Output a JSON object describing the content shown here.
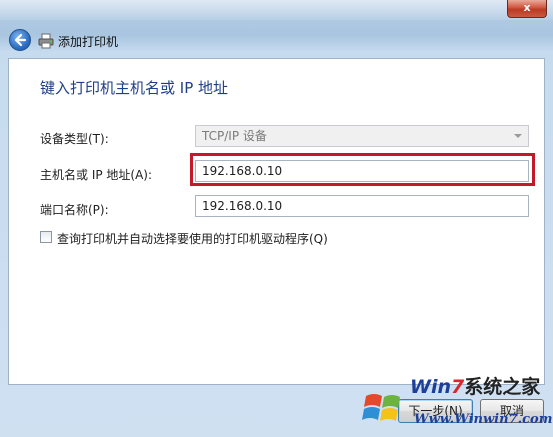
{
  "window": {
    "close_label": "x"
  },
  "nav": {
    "title": "添加打印机"
  },
  "content": {
    "heading": "键入打印机主机名或 IP 地址",
    "device_type": {
      "label": "设备类型(T):",
      "value": "TCP/IP 设备"
    },
    "hostname": {
      "label": "主机名或 IP 地址(A):",
      "value": "192.168.0.10"
    },
    "port": {
      "label": "端口名称(P):",
      "value": "192.168.0.10"
    },
    "query_checkbox": {
      "label": "查询打印机并自动选择要使用的打印机驱动程序(Q)",
      "checked": false
    }
  },
  "footer": {
    "next_label": "下一步(N)",
    "cancel_label": "取消"
  },
  "watermark": {
    "brand_w": "Win",
    "brand_7": "7",
    "brand_cn": "系统之家",
    "url": "Www.Winwin7.com"
  },
  "colors": {
    "highlight": "#c4182b",
    "heading": "#1f3f8a"
  }
}
